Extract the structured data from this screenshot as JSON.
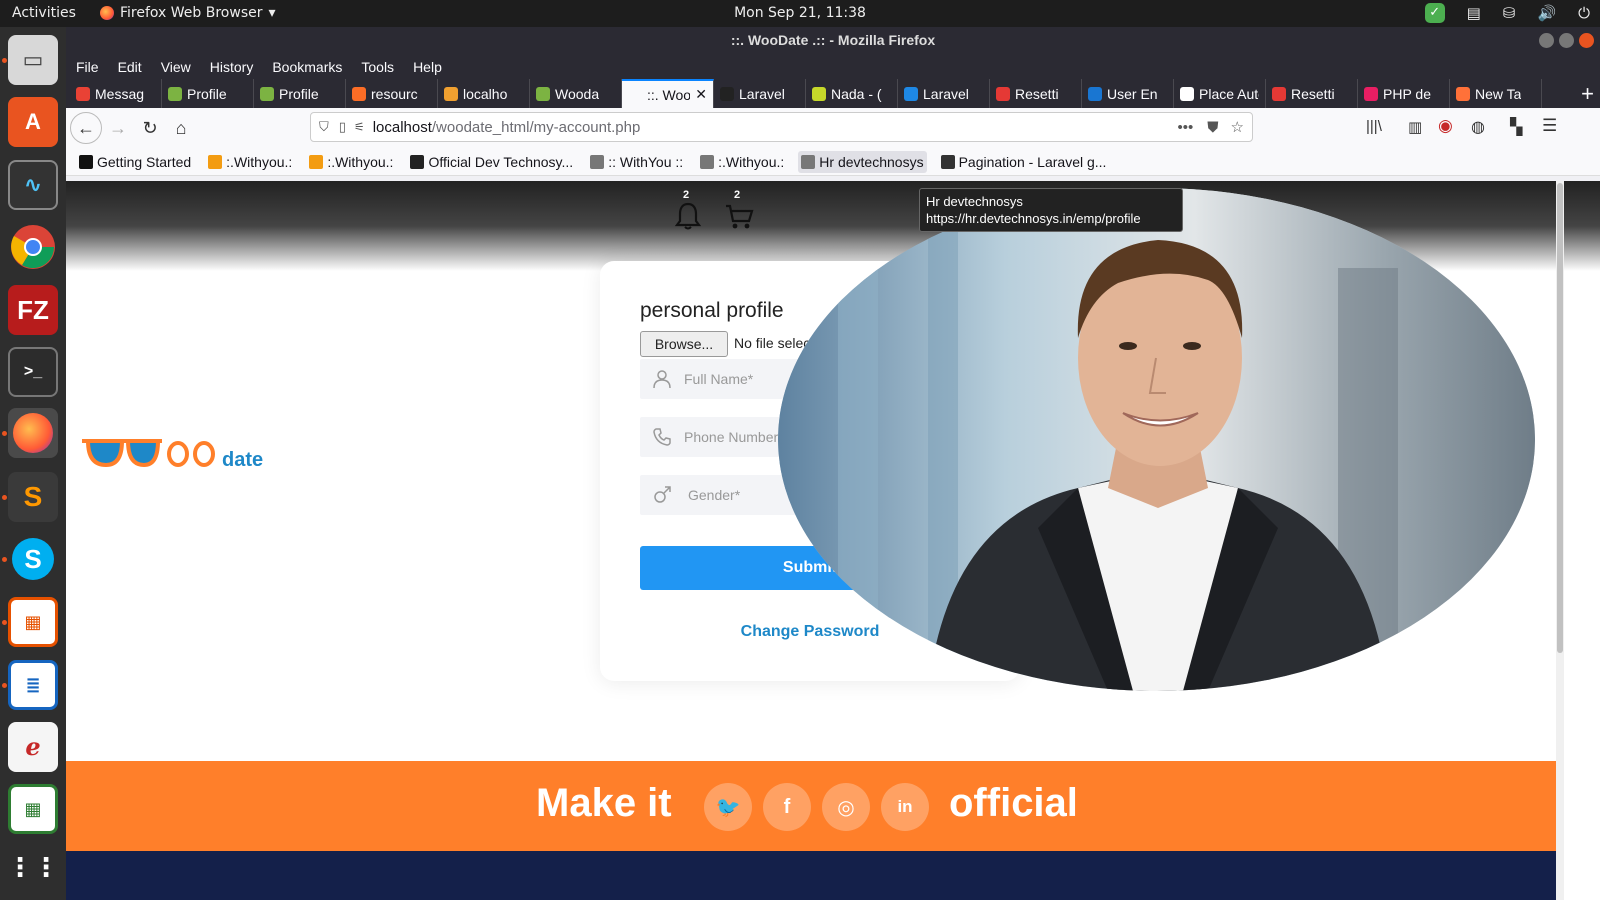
{
  "topbar": {
    "activities": "Activities",
    "app_name": "Firefox Web Browser",
    "clock": "Mon Sep 21, 11:38"
  },
  "window": {
    "title": "::. WooDate .:: - Mozilla Firefox"
  },
  "menu": [
    "File",
    "Edit",
    "View",
    "History",
    "Bookmarks",
    "Tools",
    "Help"
  ],
  "tabs": [
    {
      "label": "Messag",
      "color": "#e94235"
    },
    {
      "label": "Profile",
      "color": "#7cb342"
    },
    {
      "label": "Profile",
      "color": "#7cb342"
    },
    {
      "label": "resourc",
      "color": "#fc6d26"
    },
    {
      "label": "localho",
      "color": "#f0a030"
    },
    {
      "label": "Wooda",
      "color": "#7cb342"
    },
    {
      "label": "::. WooD",
      "color": "#ffffff",
      "active": true
    },
    {
      "label": "Laravel",
      "color": "#222222"
    },
    {
      "label": "Nada - (",
      "color": "#c6d82a"
    },
    {
      "label": "Laravel",
      "color": "#1e88e5"
    },
    {
      "label": "Resetti",
      "color": "#e53935"
    },
    {
      "label": "User En",
      "color": "#1976d2"
    },
    {
      "label": "Place Auto",
      "color": "#ffffff"
    },
    {
      "label": "Resetti",
      "color": "#e53935"
    },
    {
      "label": "PHP de",
      "color": "#e91e63"
    },
    {
      "label": "New Ta",
      "color": "#ff7139"
    }
  ],
  "address": {
    "host": "localhost",
    "path": "/woodate_html/my-account.php"
  },
  "bookmarks": [
    {
      "label": "Getting Started",
      "color": "#111111"
    },
    {
      "label": ":.Withyou.:",
      "color": "#f39c12"
    },
    {
      "label": ":.Withyou.:",
      "color": "#f39c12"
    },
    {
      "label": "Official Dev Technosy...",
      "color": "#222222"
    },
    {
      "label": ":: WithYou ::",
      "color": "#777777"
    },
    {
      "label": ":.Withyou.:",
      "color": "#777777"
    },
    {
      "label": "Hr devtechnosys",
      "color": "#777777"
    },
    {
      "label": "Pagination - Laravel g...",
      "color": "#333333"
    }
  ],
  "header": {
    "notification_count": "2",
    "cart_count": "2"
  },
  "logo": {
    "text": "date",
    "brand_orange": "#ff7f2a",
    "brand_blue": "#1e88c8"
  },
  "form": {
    "title": "personal profile",
    "browse_label": "Browse...",
    "no_file": "No file selected.",
    "full_name_placeholder": "Full Name*",
    "phone_placeholder": "Phone Number*",
    "gender_placeholder": "Gender*",
    "submit_label": "Submit",
    "change_password": "Change Password"
  },
  "tooltip": {
    "title": "Hr devtechnosys",
    "url": "https://hr.devtechnosys.in/emp/profile"
  },
  "footer": {
    "make_it": "Make it",
    "official": "official",
    "socials": [
      "twitter-icon",
      "facebook-icon",
      "instagram-icon",
      "linkedin-icon"
    ]
  }
}
